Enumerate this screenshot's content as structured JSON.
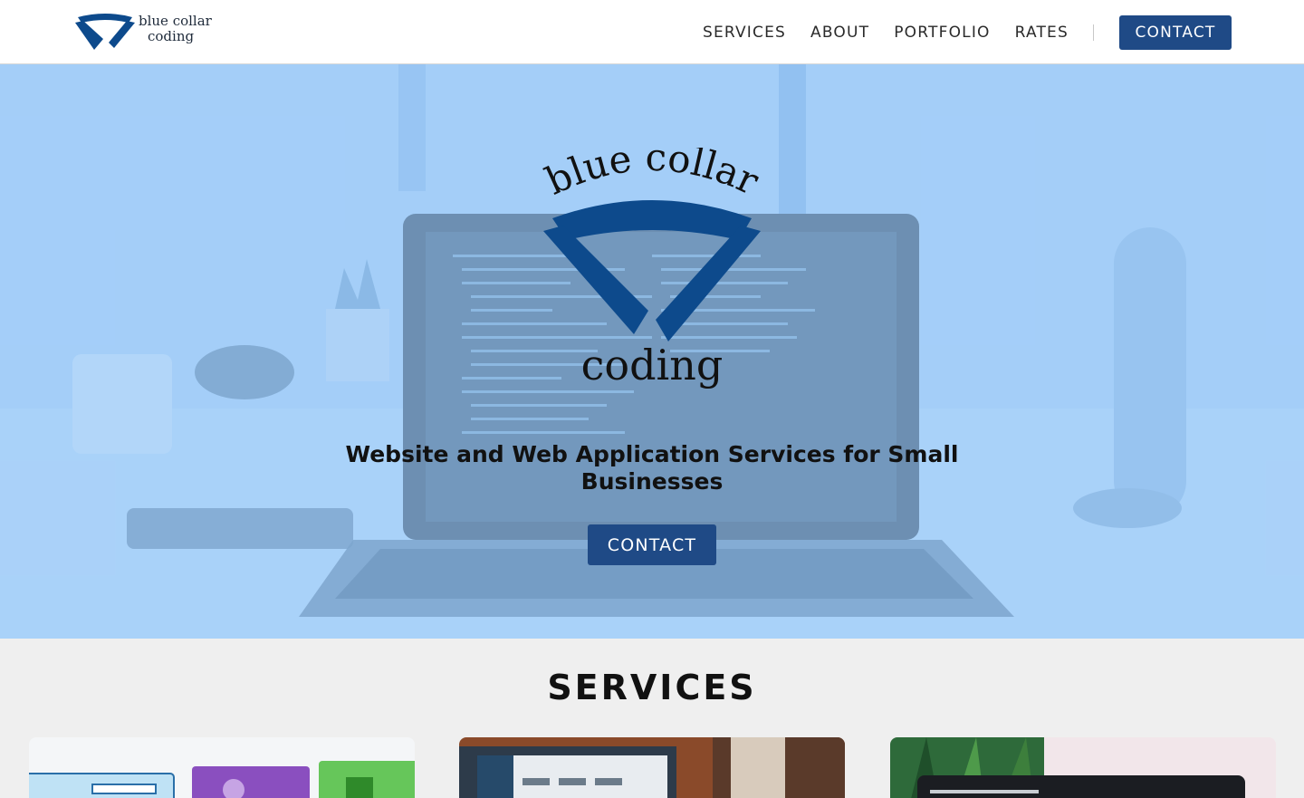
{
  "brand": {
    "line1": "blue collar",
    "line2": "coding",
    "logo_color": "#0d4a8c"
  },
  "nav": {
    "items": [
      {
        "label": "SERVICES"
      },
      {
        "label": "ABOUT"
      },
      {
        "label": "PORTFOLIO"
      },
      {
        "label": "RATES"
      }
    ],
    "contact_label": "CONTACT"
  },
  "hero": {
    "logo_top": "blue collar",
    "logo_bottom": "coding",
    "tagline": "Website and Web Application Services for Small Businesses",
    "cta_label": "CONTACT",
    "background_icon": "laptop-desk-photo"
  },
  "services": {
    "title": "SERVICES",
    "cards": [
      {
        "image": "wireframe-sketch-image"
      },
      {
        "image": "analytics-dashboard-image"
      },
      {
        "image": "monitor-plant-image"
      }
    ]
  },
  "colors": {
    "accent": "#1f4a86",
    "hero_overlay": "#96c8fa",
    "section_bg": "#efefef"
  }
}
